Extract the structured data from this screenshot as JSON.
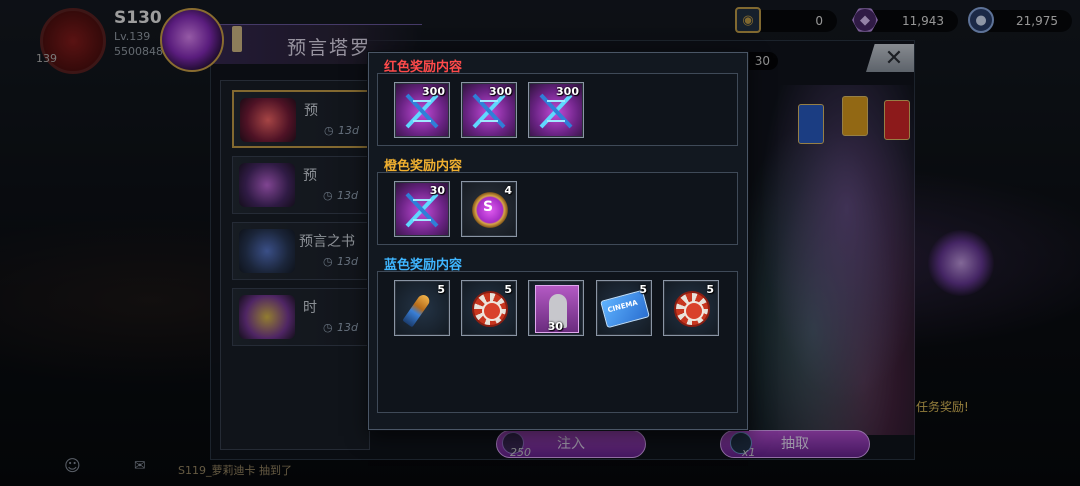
{
  "player": {
    "server": "S130",
    "level": "Lv.139",
    "power": "5500848",
    "badge_number": "139"
  },
  "currencies": [
    {
      "icon": "eye-token-icon",
      "value": "0"
    },
    {
      "icon": "purple-gem-icon",
      "value": "11,943"
    },
    {
      "icon": "blue-orb-icon",
      "value": "21,975"
    }
  ],
  "tarot": {
    "title": "预言塔罗",
    "chip_value": "30",
    "items": [
      {
        "name": "预",
        "time": "13d"
      },
      {
        "name": "预",
        "time": "13d"
      },
      {
        "name": "预言之书",
        "time": "13d"
      },
      {
        "name": "时",
        "time": "13d"
      }
    ],
    "inject_label": "注入",
    "inject_cost": "250",
    "draw_label": "抽取",
    "draw_qty": "x1",
    "task_reward": "任务奖励!"
  },
  "chat": {
    "message": "S119_萝莉迪卡 抽到了"
  },
  "reward_popup": {
    "sections": [
      {
        "title": "红色奖励内容",
        "color": "#ff4a4a",
        "items": [
          {
            "icon": "dna-icon",
            "qty": "300"
          },
          {
            "icon": "dna-icon",
            "qty": "300"
          },
          {
            "icon": "dna-icon",
            "qty": "300"
          }
        ]
      },
      {
        "title": "橙色奖励内容",
        "color": "#f0b030",
        "items": [
          {
            "icon": "dna-icon",
            "qty": "30"
          },
          {
            "icon": "bottlecap-icon",
            "qty": "4"
          }
        ]
      },
      {
        "title": "蓝色奖励内容",
        "color": "#3fb6ff",
        "items": [
          {
            "icon": "bullet-icon",
            "qty": "5"
          },
          {
            "icon": "casino-chip-icon",
            "qty": "5"
          },
          {
            "icon": "portrait-card-icon",
            "qty": "30"
          },
          {
            "icon": "cinema-ticket-icon",
            "qty": "5"
          },
          {
            "icon": "casino-chip-icon",
            "qty": "5"
          }
        ]
      }
    ]
  }
}
